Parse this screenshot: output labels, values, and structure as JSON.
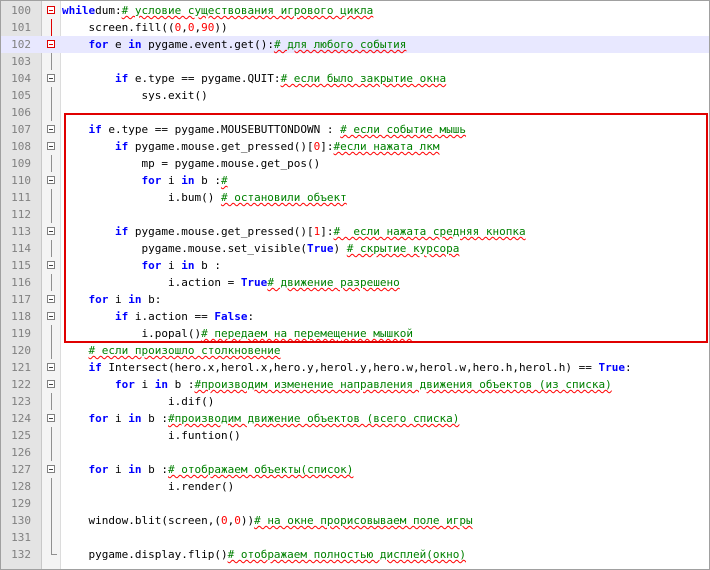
{
  "lines": [
    {
      "n": "100",
      "fold": "red",
      "parts": [
        [
          "kw",
          "while"
        ],
        [
          "",
          "dum:"
        ],
        [
          "cm",
          "# условие существования игрового цикла"
        ]
      ]
    },
    {
      "n": "101",
      "fold": "",
      "parts": [
        [
          "",
          "    screen.fill(("
        ],
        [
          "num",
          "0"
        ],
        [
          "",
          ","
        ],
        [
          "num",
          "0"
        ],
        [
          "",
          ","
        ],
        [
          "num",
          "90"
        ],
        [
          "",
          "))"
        ]
      ]
    },
    {
      "n": "102",
      "fold": "red",
      "parts": [
        [
          "",
          "    "
        ],
        [
          "kw",
          "for"
        ],
        [
          "",
          " e "
        ],
        [
          "kw",
          "in"
        ],
        [
          "",
          " pygame.event.get():"
        ],
        [
          "cm",
          "# для любого события"
        ]
      ]
    },
    {
      "n": "103",
      "fold": "",
      "parts": []
    },
    {
      "n": "104",
      "fold": "box",
      "parts": [
        [
          "",
          "        "
        ],
        [
          "kw",
          "if"
        ],
        [
          "",
          " e.type == pygame.QUIT:"
        ],
        [
          "cm",
          "# если было закрытие окна"
        ]
      ]
    },
    {
      "n": "105",
      "fold": "",
      "parts": [
        [
          "",
          "            sys.exit()"
        ]
      ]
    },
    {
      "n": "106",
      "fold": "",
      "parts": []
    },
    {
      "n": "107",
      "fold": "box",
      "parts": [
        [
          "",
          "    "
        ],
        [
          "kw",
          "if"
        ],
        [
          "",
          " e.type == pygame.MOUSEBUTTONDOWN : "
        ],
        [
          "cm",
          "# если событие мышь"
        ]
      ]
    },
    {
      "n": "108",
      "fold": "box",
      "parts": [
        [
          "",
          "        "
        ],
        [
          "kw",
          "if"
        ],
        [
          "",
          " pygame.mouse.get_pressed()["
        ],
        [
          "num",
          "0"
        ],
        [
          "",
          "]:"
        ],
        [
          "cm",
          "#если нажата лкм"
        ]
      ]
    },
    {
      "n": "109",
      "fold": "",
      "parts": [
        [
          "",
          "            mp = pygame.mouse.get_pos()"
        ]
      ]
    },
    {
      "n": "110",
      "fold": "box",
      "parts": [
        [
          "",
          "            "
        ],
        [
          "kw",
          "for"
        ],
        [
          "",
          " i "
        ],
        [
          "kw",
          "in"
        ],
        [
          "",
          " b :"
        ],
        [
          "cm",
          "#"
        ]
      ]
    },
    {
      "n": "111",
      "fold": "",
      "parts": [
        [
          "",
          "                i.bum() "
        ],
        [
          "cm",
          "# остановили объект"
        ]
      ]
    },
    {
      "n": "112",
      "fold": "",
      "parts": []
    },
    {
      "n": "113",
      "fold": "box",
      "parts": [
        [
          "",
          "        "
        ],
        [
          "kw",
          "if"
        ],
        [
          "",
          " pygame.mouse.get_pressed()["
        ],
        [
          "num",
          "1"
        ],
        [
          "",
          "]:"
        ],
        [
          "cm",
          "#  если нажата средняя кнопка"
        ]
      ]
    },
    {
      "n": "114",
      "fold": "",
      "parts": [
        [
          "",
          "            pygame.mouse.set_visible("
        ],
        [
          "kw",
          "True"
        ],
        [
          "",
          ") "
        ],
        [
          "cm",
          "# скрытие курсора"
        ]
      ]
    },
    {
      "n": "115",
      "fold": "box",
      "parts": [
        [
          "",
          "            "
        ],
        [
          "kw",
          "for"
        ],
        [
          "",
          " i "
        ],
        [
          "kw",
          "in"
        ],
        [
          "",
          " b :"
        ]
      ]
    },
    {
      "n": "116",
      "fold": "",
      "parts": [
        [
          "",
          "                i.action = "
        ],
        [
          "kw",
          "True"
        ],
        [
          "cm",
          "# движение разрешено"
        ]
      ]
    },
    {
      "n": "117",
      "fold": "box",
      "parts": [
        [
          "",
          "    "
        ],
        [
          "kw",
          "for"
        ],
        [
          "",
          " i "
        ],
        [
          "kw",
          "in"
        ],
        [
          "",
          " b:"
        ]
      ]
    },
    {
      "n": "118",
      "fold": "box",
      "parts": [
        [
          "",
          "        "
        ],
        [
          "kw",
          "if"
        ],
        [
          "",
          " i.action == "
        ],
        [
          "kw",
          "False"
        ],
        [
          "",
          ":"
        ]
      ]
    },
    {
      "n": "119",
      "fold": "",
      "parts": [
        [
          "",
          "            i.popal()"
        ],
        [
          "cm",
          "# передаем на перемещение мышкой"
        ]
      ]
    },
    {
      "n": "120",
      "fold": "",
      "parts": [
        [
          "",
          "    "
        ],
        [
          "cm",
          "# если произошло столкновение"
        ]
      ]
    },
    {
      "n": "121",
      "fold": "box",
      "parts": [
        [
          "",
          "    "
        ],
        [
          "kw",
          "if"
        ],
        [
          "",
          " Intersect(hero.x,herol.x,hero.y,herol.y,hero.w,herol.w,hero.h,herol.h) == "
        ],
        [
          "kw",
          "True"
        ],
        [
          "",
          ":"
        ]
      ]
    },
    {
      "n": "122",
      "fold": "box",
      "parts": [
        [
          "",
          "        "
        ],
        [
          "kw",
          "for"
        ],
        [
          "",
          " i "
        ],
        [
          "kw",
          "in"
        ],
        [
          "",
          " b :"
        ],
        [
          "cm",
          "#производим изменение направления движения объектов (из списка)"
        ]
      ]
    },
    {
      "n": "123",
      "fold": "",
      "parts": [
        [
          "",
          "                i.dif()"
        ]
      ]
    },
    {
      "n": "124",
      "fold": "box",
      "parts": [
        [
          "",
          "    "
        ],
        [
          "kw",
          "for"
        ],
        [
          "",
          " i "
        ],
        [
          "kw",
          "in"
        ],
        [
          "",
          " b :"
        ],
        [
          "cm",
          "#производим движение объектов (всего списка)"
        ]
      ]
    },
    {
      "n": "125",
      "fold": "",
      "parts": [
        [
          "",
          "                i.funtion()"
        ]
      ]
    },
    {
      "n": "126",
      "fold": "",
      "parts": []
    },
    {
      "n": "127",
      "fold": "box",
      "parts": [
        [
          "",
          "    "
        ],
        [
          "kw",
          "for"
        ],
        [
          "",
          " i "
        ],
        [
          "kw",
          "in"
        ],
        [
          "",
          " b :"
        ],
        [
          "cm",
          "# отображаем объекты(список)"
        ]
      ]
    },
    {
      "n": "128",
      "fold": "",
      "parts": [
        [
          "",
          "                i.render()"
        ]
      ]
    },
    {
      "n": "129",
      "fold": "",
      "parts": []
    },
    {
      "n": "130",
      "fold": "",
      "parts": [
        [
          "",
          "    window.blit(screen,("
        ],
        [
          "num",
          "0"
        ],
        [
          "",
          ","
        ],
        [
          "num",
          "0"
        ],
        [
          "",
          "))"
        ],
        [
          "cm",
          "# на окне прорисовываем поле игры"
        ]
      ]
    },
    {
      "n": "131",
      "fold": "",
      "parts": []
    },
    {
      "n": "132",
      "fold": "",
      "parts": [
        [
          "",
          "    pygame.display.flip()"
        ],
        [
          "cm",
          "# отображаем полностью дисплей(окно)"
        ]
      ]
    }
  ],
  "current_line": "102",
  "colors": {
    "keyword": "#0000ff",
    "number": "#ff0000",
    "comment": "#008000",
    "highlight_box": "#e00000"
  }
}
